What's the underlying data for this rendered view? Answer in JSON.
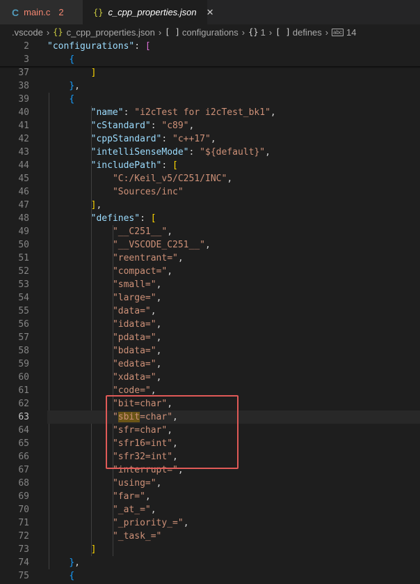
{
  "tabs": [
    {
      "icon": "C",
      "title": "main.c",
      "badge": "2",
      "active": false
    },
    {
      "icon": "{}",
      "title": "c_cpp_properties.json",
      "close": "✕",
      "active": true
    }
  ],
  "breadcrumb": {
    "folder": ".vscode",
    "file": "c_cpp_properties.json",
    "node1": "configurations",
    "node2": "1",
    "node3": "defines",
    "node4": "14",
    "sym_array": "[ ]",
    "sym_obj": "{}",
    "sym_json": "{}",
    "sym_abc": "abc",
    "sep": "›"
  },
  "editor": {
    "current_line": "63",
    "lines": [
      {
        "n": "2",
        "text": "    \"configurations\": ["
      },
      {
        "n": "3",
        "text": "        {"
      },
      {
        "n": "37",
        "text": "            ]"
      },
      {
        "n": "38",
        "text": "        },"
      },
      {
        "n": "39",
        "text": "        {"
      },
      {
        "n": "40",
        "text": "            \"name\": \"i2cTest for i2cTest_bk1\","
      },
      {
        "n": "41",
        "text": "            \"cStandard\": \"c89\","
      },
      {
        "n": "42",
        "text": "            \"cppStandard\": \"c++17\","
      },
      {
        "n": "43",
        "text": "            \"intelliSenseMode\": \"${default}\","
      },
      {
        "n": "44",
        "text": "            \"includePath\": ["
      },
      {
        "n": "45",
        "text": "                \"C:/Keil_v5/C251/INC\","
      },
      {
        "n": "46",
        "text": "                \"Sources/inc\""
      },
      {
        "n": "47",
        "text": "            ],"
      },
      {
        "n": "48",
        "text": "            \"defines\": ["
      },
      {
        "n": "49",
        "text": "                \"__C251__\","
      },
      {
        "n": "50",
        "text": "                \"__VSCODE_C251__\","
      },
      {
        "n": "51",
        "text": "                \"reentrant=\","
      },
      {
        "n": "52",
        "text": "                \"compact=\","
      },
      {
        "n": "53",
        "text": "                \"small=\","
      },
      {
        "n": "54",
        "text": "                \"large=\","
      },
      {
        "n": "55",
        "text": "                \"data=\","
      },
      {
        "n": "56",
        "text": "                \"idata=\","
      },
      {
        "n": "57",
        "text": "                \"pdata=\","
      },
      {
        "n": "58",
        "text": "                \"bdata=\","
      },
      {
        "n": "59",
        "text": "                \"edata=\","
      },
      {
        "n": "60",
        "text": "                \"xdata=\","
      },
      {
        "n": "61",
        "text": "                \"code=\","
      },
      {
        "n": "62",
        "text": "                \"bit=char\","
      },
      {
        "n": "63",
        "text": "                \"sbit=char\","
      },
      {
        "n": "64",
        "text": "                \"sfr=char\","
      },
      {
        "n": "65",
        "text": "                \"sfr16=int\","
      },
      {
        "n": "66",
        "text": "                \"sfr32=int\","
      },
      {
        "n": "67",
        "text": "                \"interrupt=\","
      },
      {
        "n": "68",
        "text": "                \"using=\","
      },
      {
        "n": "69",
        "text": "                \"far=\","
      },
      {
        "n": "70",
        "text": "                \"_at_=\","
      },
      {
        "n": "71",
        "text": "                \"_priority_=\","
      },
      {
        "n": "72",
        "text": "                \"_task_=\""
      },
      {
        "n": "73",
        "text": "            ]"
      },
      {
        "n": "74",
        "text": "        },"
      },
      {
        "n": "75",
        "text": "        {"
      }
    ],
    "highlight_word": "sbit"
  },
  "colors": {
    "key": "#9cdcfe",
    "string": "#ce9178",
    "bracket_level1": "#ffd700",
    "bracket_level2": "#da70d6",
    "bracket_level3": "#179fff",
    "annotation_box": "#e05a57"
  }
}
